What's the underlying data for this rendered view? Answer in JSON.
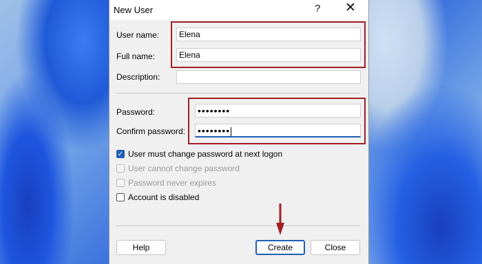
{
  "window": {
    "title": "New User",
    "help_glyph": "?",
    "close_glyph": "✕"
  },
  "form": {
    "username_label": "User name:",
    "username_value": "Elena",
    "fullname_label": "Full name:",
    "fullname_value": "Elena",
    "description_label": "Description:",
    "description_value": "",
    "password_label": "Password:",
    "password_value": "••••••••",
    "confirm_label": "Confirm password:",
    "confirm_value": "••••••••"
  },
  "options": [
    {
      "label": "User must change password at next logon",
      "checked": true,
      "enabled": true
    },
    {
      "label": "User cannot change password",
      "checked": false,
      "enabled": false
    },
    {
      "label": "Password never expires",
      "checked": false,
      "enabled": false
    },
    {
      "label": "Account is disabled",
      "checked": false,
      "enabled": true
    }
  ],
  "buttons": {
    "help": "Help",
    "create": "Create",
    "close": "Close"
  },
  "colors": {
    "annotation": "#a01e22",
    "accent": "#1f5fb4"
  }
}
